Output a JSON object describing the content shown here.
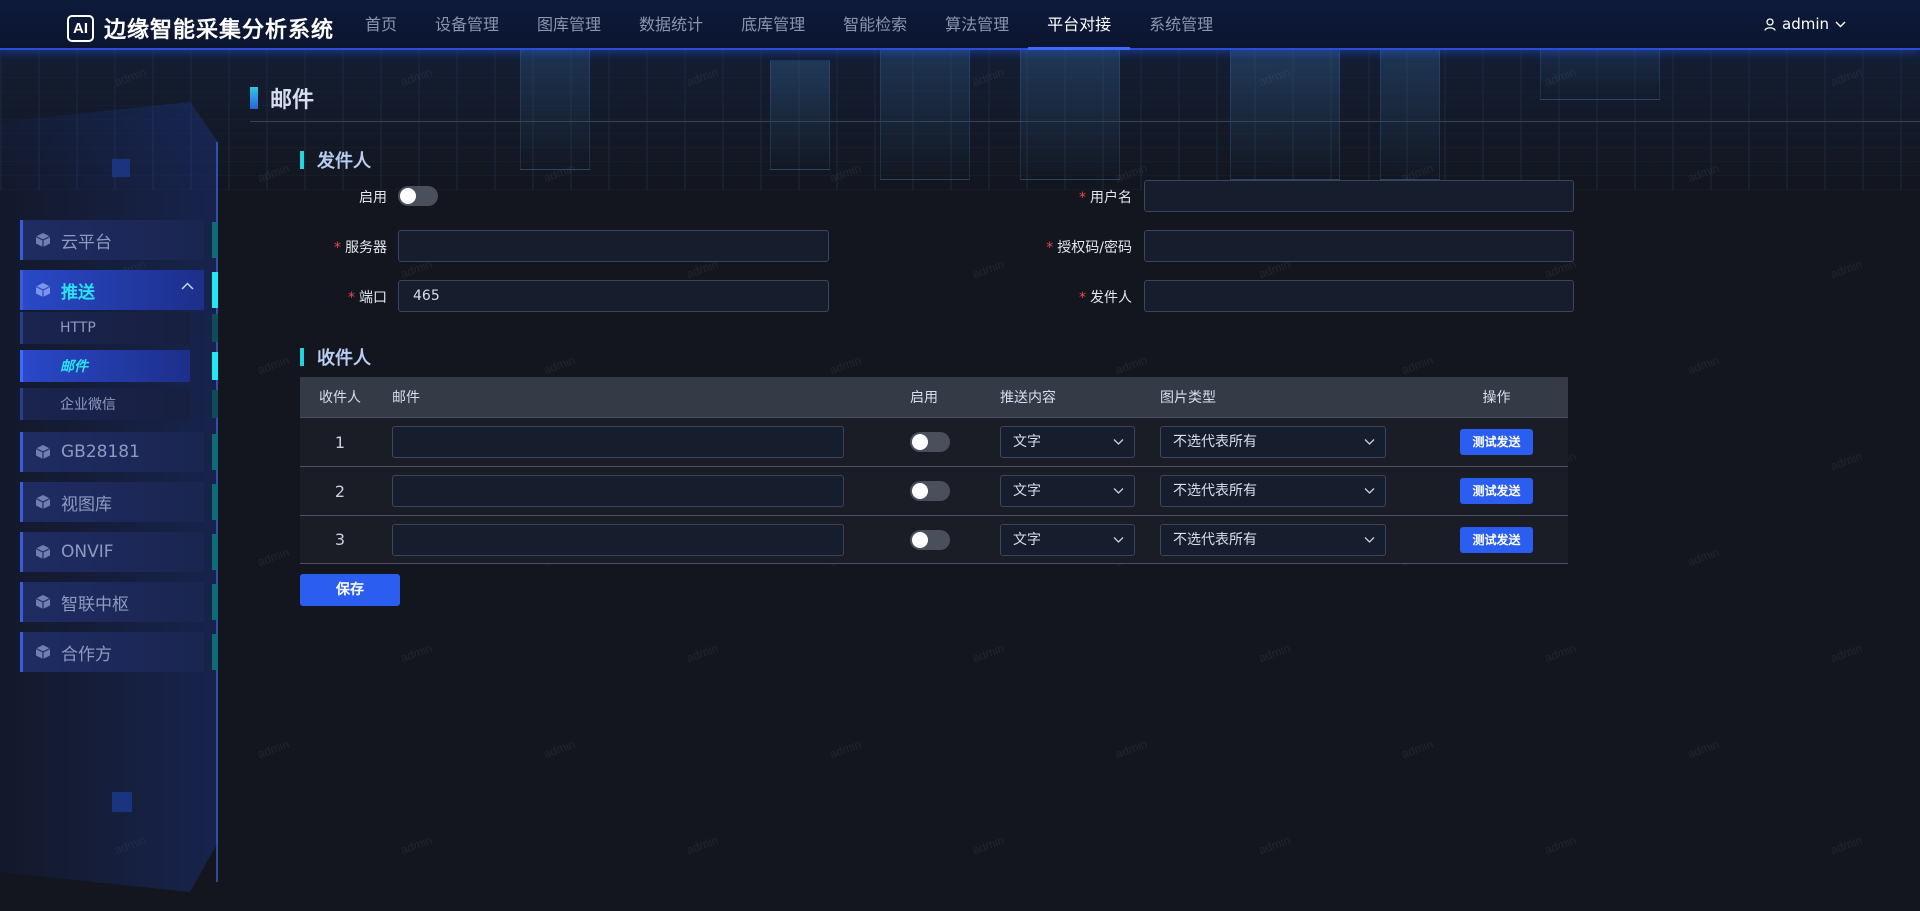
{
  "app": {
    "logo_badge": "AI",
    "title": "边缘智能采集分析系统",
    "user": "admin"
  },
  "nav": [
    {
      "label": "首页",
      "active": false
    },
    {
      "label": "设备管理",
      "active": false
    },
    {
      "label": "图库管理",
      "active": false
    },
    {
      "label": "数据统计",
      "active": false
    },
    {
      "label": "底库管理",
      "active": false
    },
    {
      "label": "智能检索",
      "active": false
    },
    {
      "label": "算法管理",
      "active": false
    },
    {
      "label": "平台对接",
      "active": true
    },
    {
      "label": "系统管理",
      "active": false
    }
  ],
  "sidebar": {
    "items": [
      {
        "label": "云平台"
      },
      {
        "label": "推送"
      },
      {
        "label": "GB28181"
      },
      {
        "label": "视图库"
      },
      {
        "label": "ONVIF"
      },
      {
        "label": "智联中枢"
      },
      {
        "label": "合作方"
      }
    ],
    "push_sub": [
      {
        "label": "HTTP"
      },
      {
        "label": "邮件"
      },
      {
        "label": "企业微信"
      }
    ]
  },
  "page": {
    "title": "邮件"
  },
  "sender": {
    "section_title": "发件人",
    "enable_label": "启用",
    "enabled": false,
    "username_label": "用户名",
    "username_value": "",
    "server_label": "服务器",
    "server_value": "",
    "auth_label": "授权码/密码",
    "auth_value": "",
    "port_label": "端口",
    "port_value": "465",
    "from_label": "发件人",
    "from_value": "",
    "required_mark": "*"
  },
  "receivers": {
    "section_title": "收件人",
    "headers": {
      "index": "收件人",
      "email": "邮件",
      "enable": "启用",
      "content": "推送内容",
      "image_type": "图片类型",
      "action": "操作"
    },
    "rows": [
      {
        "index": "1",
        "email": "",
        "enabled": false,
        "content": "文字",
        "image_type": "不选代表所有",
        "action": "测试发送"
      },
      {
        "index": "2",
        "email": "",
        "enabled": false,
        "content": "文字",
        "image_type": "不选代表所有",
        "action": "测试发送"
      },
      {
        "index": "3",
        "email": "",
        "enabled": false,
        "content": "文字",
        "image_type": "不选代表所有",
        "action": "测试发送"
      }
    ]
  },
  "save_label": "保存",
  "watermark": "admin",
  "colors": {
    "accent": "#2a5df0",
    "cyan": "#22d3e0",
    "required": "#f04848",
    "background": "#13161f"
  }
}
